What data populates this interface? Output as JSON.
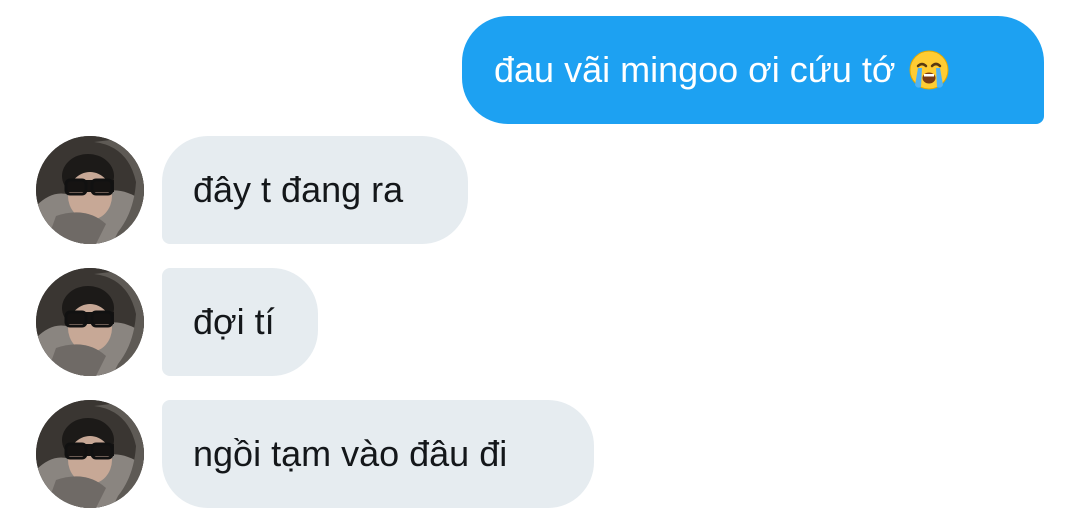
{
  "conversation": {
    "outgoing": [
      {
        "text": "đau vãi mingoo ơi cứu tớ",
        "emoji": "loudly-crying-face-emoji"
      }
    ],
    "incoming": [
      {
        "text": "đây t đang ra"
      },
      {
        "text": "đợi tí"
      },
      {
        "text": "ngồi tạm vào đâu đi"
      }
    ]
  },
  "colors": {
    "outgoing_bubble": "#1da1f2",
    "incoming_bubble": "#e6ecf0",
    "incoming_text": "#14171a",
    "outgoing_text": "#ffffff"
  }
}
